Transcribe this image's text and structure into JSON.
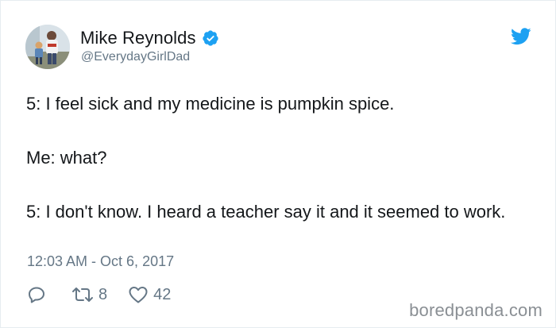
{
  "tweet": {
    "author": {
      "display_name": "Mike Reynolds",
      "handle": "@EverydayGirlDad",
      "verified": true
    },
    "body": [
      "5: I feel sick and my medicine is pumpkin spice.",
      "Me: what?",
      "5: I don't know. I heard a teacher say it and it seemed to work."
    ],
    "timestamp": "12:03 AM - Oct 6, 2017",
    "actions": {
      "reply_icon": "reply-icon",
      "retweet_icon": "retweet-icon",
      "retweet_count": "8",
      "like_icon": "heart-icon",
      "like_count": "42"
    }
  },
  "brand": {
    "logo": "twitter-bird-icon",
    "accent_color": "#1da1f2"
  },
  "watermark": "boredpanda.com",
  "colors": {
    "text_primary": "#14171a",
    "text_secondary": "#657786",
    "border": "#e6ecf0",
    "watermark": "#8a8f94"
  }
}
